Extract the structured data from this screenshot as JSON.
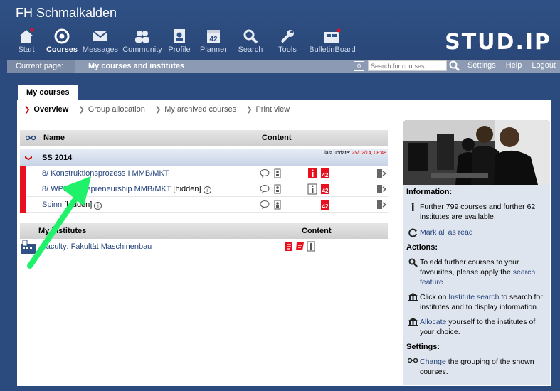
{
  "header": {
    "title": "FH Schmalkalden",
    "logo": "STUD.IP",
    "nav": [
      {
        "label": "Start",
        "icon": "home-icon"
      },
      {
        "label": "Courses",
        "icon": "courses-icon",
        "active": true
      },
      {
        "label": "Messages",
        "icon": "envelope-icon"
      },
      {
        "label": "Community",
        "icon": "people-icon"
      },
      {
        "label": "Profile",
        "icon": "profile-icon"
      },
      {
        "label": "Planner",
        "icon": "calendar-icon"
      },
      {
        "label": "Search",
        "icon": "search-icon"
      },
      {
        "label": "Tools",
        "icon": "wrench-icon"
      },
      {
        "label": "BulletinBoard",
        "icon": "board-icon"
      }
    ],
    "calendar_day": "42"
  },
  "bar": {
    "current_page_label": "Current page:",
    "current_page_value": "My courses and institutes",
    "counter": "0",
    "search_placeholder": "Search for courses",
    "links": [
      "Settings",
      "Help",
      "Logout"
    ]
  },
  "tab": "My courses",
  "subnav": [
    {
      "label": "Overview",
      "active": true
    },
    {
      "label": "Group allocation"
    },
    {
      "label": "My archived courses"
    },
    {
      "label": "Print view"
    }
  ],
  "courses": {
    "headers": {
      "name": "Name",
      "content": "Content"
    },
    "semester": "SS 2014",
    "last_update_label": "last update:",
    "last_update_value": "25/02/14, 08:48",
    "rows": [
      {
        "title": "8/ Konstruktionsprozess I MMB/MKT",
        "hidden": ""
      },
      {
        "title": "8/ WPM Entrepreneurship MMB/MKT",
        "hidden": "[hidden]"
      },
      {
        "title": "Spinn",
        "hidden": "[hidden]"
      }
    ]
  },
  "institutes": {
    "headers": {
      "name": "My institutes",
      "content": "Content"
    },
    "rows": [
      {
        "title": "Faculty: Fakultät Maschinenbau"
      }
    ]
  },
  "sidebar": {
    "information_heading": "Information:",
    "info_text": "Further 799 courses and further 62 institutes are available.",
    "mark_read": "Mark all as read",
    "actions_heading": "Actions:",
    "action1_pre": "To add further courses to your favourites, please apply the ",
    "action1_link": "search feature",
    "action2_pre": "Click on ",
    "action2_link": "Institute search",
    "action2_post": " to search for institutes and to display information.",
    "action3_link": "Allocate",
    "action3_post": " yourself to the institutes of your choice.",
    "settings_heading": "Settings:",
    "settings_link": "Change",
    "settings_post": " the grouping of the shown courses."
  },
  "colors": {
    "accent_red": "#e8101e",
    "link": "#24437c",
    "header_blue": "#2f5185",
    "arrow_green": "#1ff26a"
  }
}
